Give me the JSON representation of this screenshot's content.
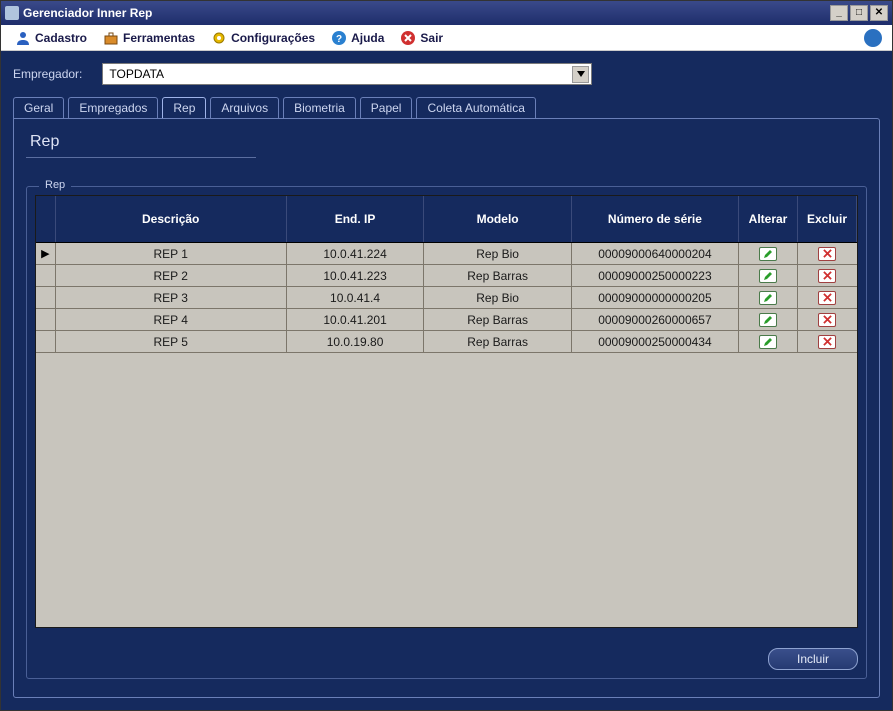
{
  "window": {
    "title": "Gerenciador Inner Rep"
  },
  "menu": {
    "cadastro": "Cadastro",
    "ferramentas": "Ferramentas",
    "configuracoes": "Configurações",
    "ajuda": "Ajuda",
    "sair": "Sair"
  },
  "employer": {
    "label": "Empregador:",
    "value": "TOPDATA"
  },
  "tabs": {
    "geral": "Geral",
    "empregados": "Empregados",
    "rep": "Rep",
    "arquivos": "Arquivos",
    "biometria": "Biometria",
    "papel": "Papel",
    "coleta": "Coleta Automática"
  },
  "panel": {
    "title": "Rep"
  },
  "fieldset": {
    "legend": "Rep"
  },
  "grid": {
    "headers": {
      "descricao": "Descrição",
      "ip": "End. IP",
      "modelo": "Modelo",
      "serie": "Número de série",
      "alterar": "Alterar",
      "excluir": "Excluir"
    },
    "rows": [
      {
        "desc": "REP 1",
        "ip": "10.0.41.224",
        "modelo": "Rep Bio",
        "serie": "00009000640000204"
      },
      {
        "desc": "REP 2",
        "ip": "10.0.41.223",
        "modelo": "Rep Barras",
        "serie": "00009000250000223"
      },
      {
        "desc": "REP 3",
        "ip": "10.0.41.4",
        "modelo": "Rep Bio",
        "serie": "00009000000000205"
      },
      {
        "desc": "REP 4",
        "ip": "10.0.41.201",
        "modelo": "Rep Barras",
        "serie": "00009000260000657"
      },
      {
        "desc": "REP 5",
        "ip": "10.0.19.80",
        "modelo": "Rep Barras",
        "serie": "00009000250000434"
      }
    ]
  },
  "buttons": {
    "incluir": "Incluir"
  }
}
